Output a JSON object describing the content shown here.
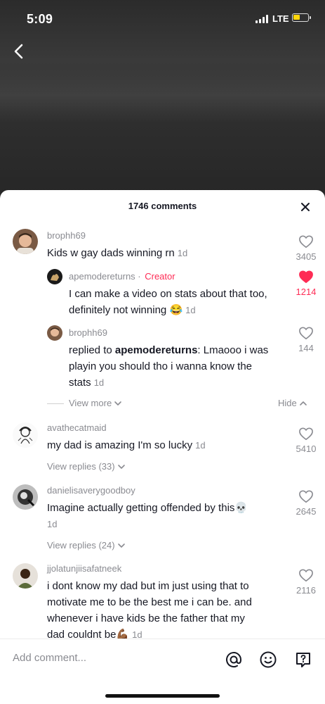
{
  "status": {
    "time": "5:09",
    "network": "LTE"
  },
  "header": {
    "comment_count": "1746 comments"
  },
  "comments": [
    {
      "username": "brophh69",
      "text": "Kids w gay dads winning rn",
      "time": "1d",
      "likes": "3405",
      "liked": false
    },
    {
      "username": "apemodereturns",
      "badge": "Creator",
      "text_line1": "I can make a video on stats about that too,",
      "text_line2": "definitely not winning",
      "emoji": "😂",
      "time": "1d",
      "likes": "1214",
      "liked": true
    },
    {
      "username": "brophh69",
      "reply_prefix": "replied to ",
      "reply_target": "apemodereturns",
      "text_line1_rest": ": Lmaooo i was",
      "text_line2": "playin you should tho i wanna know the",
      "text_line3": "stats",
      "time": "1d",
      "likes": "144",
      "liked": false
    },
    {
      "username": "avathecatmaid",
      "text": "my dad is amazing I'm so lucky",
      "time": "1d",
      "likes": "5410",
      "liked": false
    },
    {
      "username": "danielisaverygoodboy",
      "text": "Imagine actually getting offended by this",
      "emoji": "💀",
      "time": "1d",
      "likes": "2645",
      "liked": false
    },
    {
      "username": "jjolatunjiisafatneek",
      "text_line1": "i dont know my dad but im just using that to",
      "text_line2": "motivate me to be the best me i can be. and",
      "text_line3": "whenever i have kids be the father that my",
      "text_line4": "dad couldnt be",
      "emoji": "💪🏾",
      "time": "1d",
      "likes": "2116",
      "liked": false
    }
  ],
  "links": {
    "view_more": "View more",
    "hide": "Hide",
    "view_replies_1": "View replies (33)",
    "view_replies_2": "View replies (24)"
  },
  "footer": {
    "placeholder": "Add comment..."
  },
  "colors": {
    "accent": "#fe2c55",
    "muted": "#8a8b91",
    "text": "#161823"
  },
  "icons": [
    "back-icon",
    "close-icon",
    "heart-icon",
    "chevron-down-icon",
    "chevron-up-icon",
    "at-icon",
    "emoji-icon",
    "question-bubble-icon"
  ]
}
